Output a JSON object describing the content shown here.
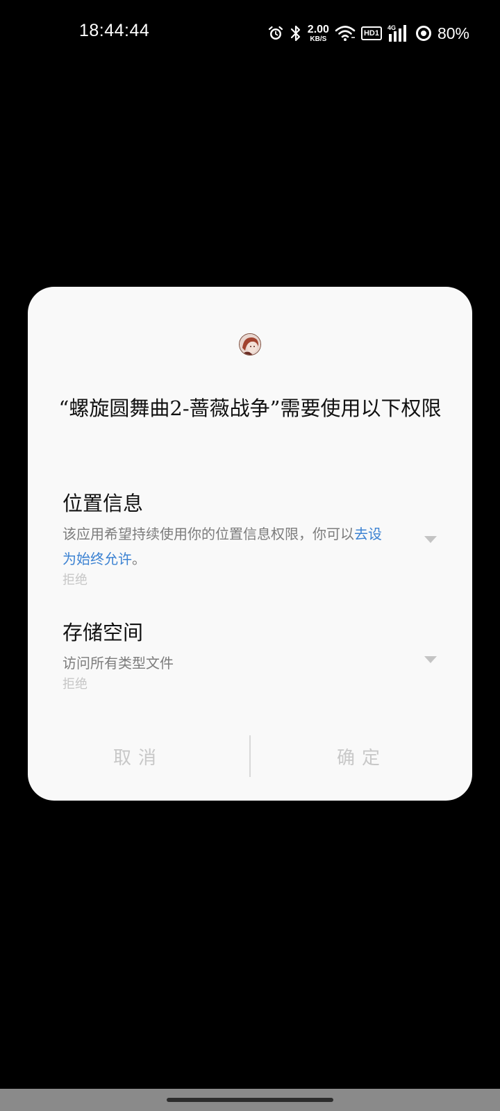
{
  "status_bar": {
    "time": "18:44:44",
    "net_speed_value": "2.00",
    "net_speed_unit": "KB/S",
    "hd_label": "HD1",
    "network_type": "4G",
    "battery": "80%",
    "icons": [
      "alarm-icon",
      "bluetooth-icon",
      "wifi-icon",
      "hd-volte-icon",
      "signal-icon",
      "battery-ring-icon"
    ]
  },
  "dialog": {
    "app_icon": "app-avatar-icon",
    "title": "“螺旋圆舞曲2-蔷薇战争”需要使用以下权限",
    "permissions": [
      {
        "title": "位置信息",
        "desc_prefix": "该应用希望持续使用你的位置信息权限，你可以",
        "desc_link": "去设为始终允许",
        "desc_suffix": "。",
        "status": "拒绝"
      },
      {
        "title": "存储空间",
        "desc": "访问所有类型文件",
        "status": "拒绝"
      }
    ],
    "cancel_label": "取消",
    "confirm_label": "确定"
  },
  "colors": {
    "link": "#3c82d2",
    "dialog_bg": "#f9f9f9",
    "screen_bg": "#000000"
  }
}
